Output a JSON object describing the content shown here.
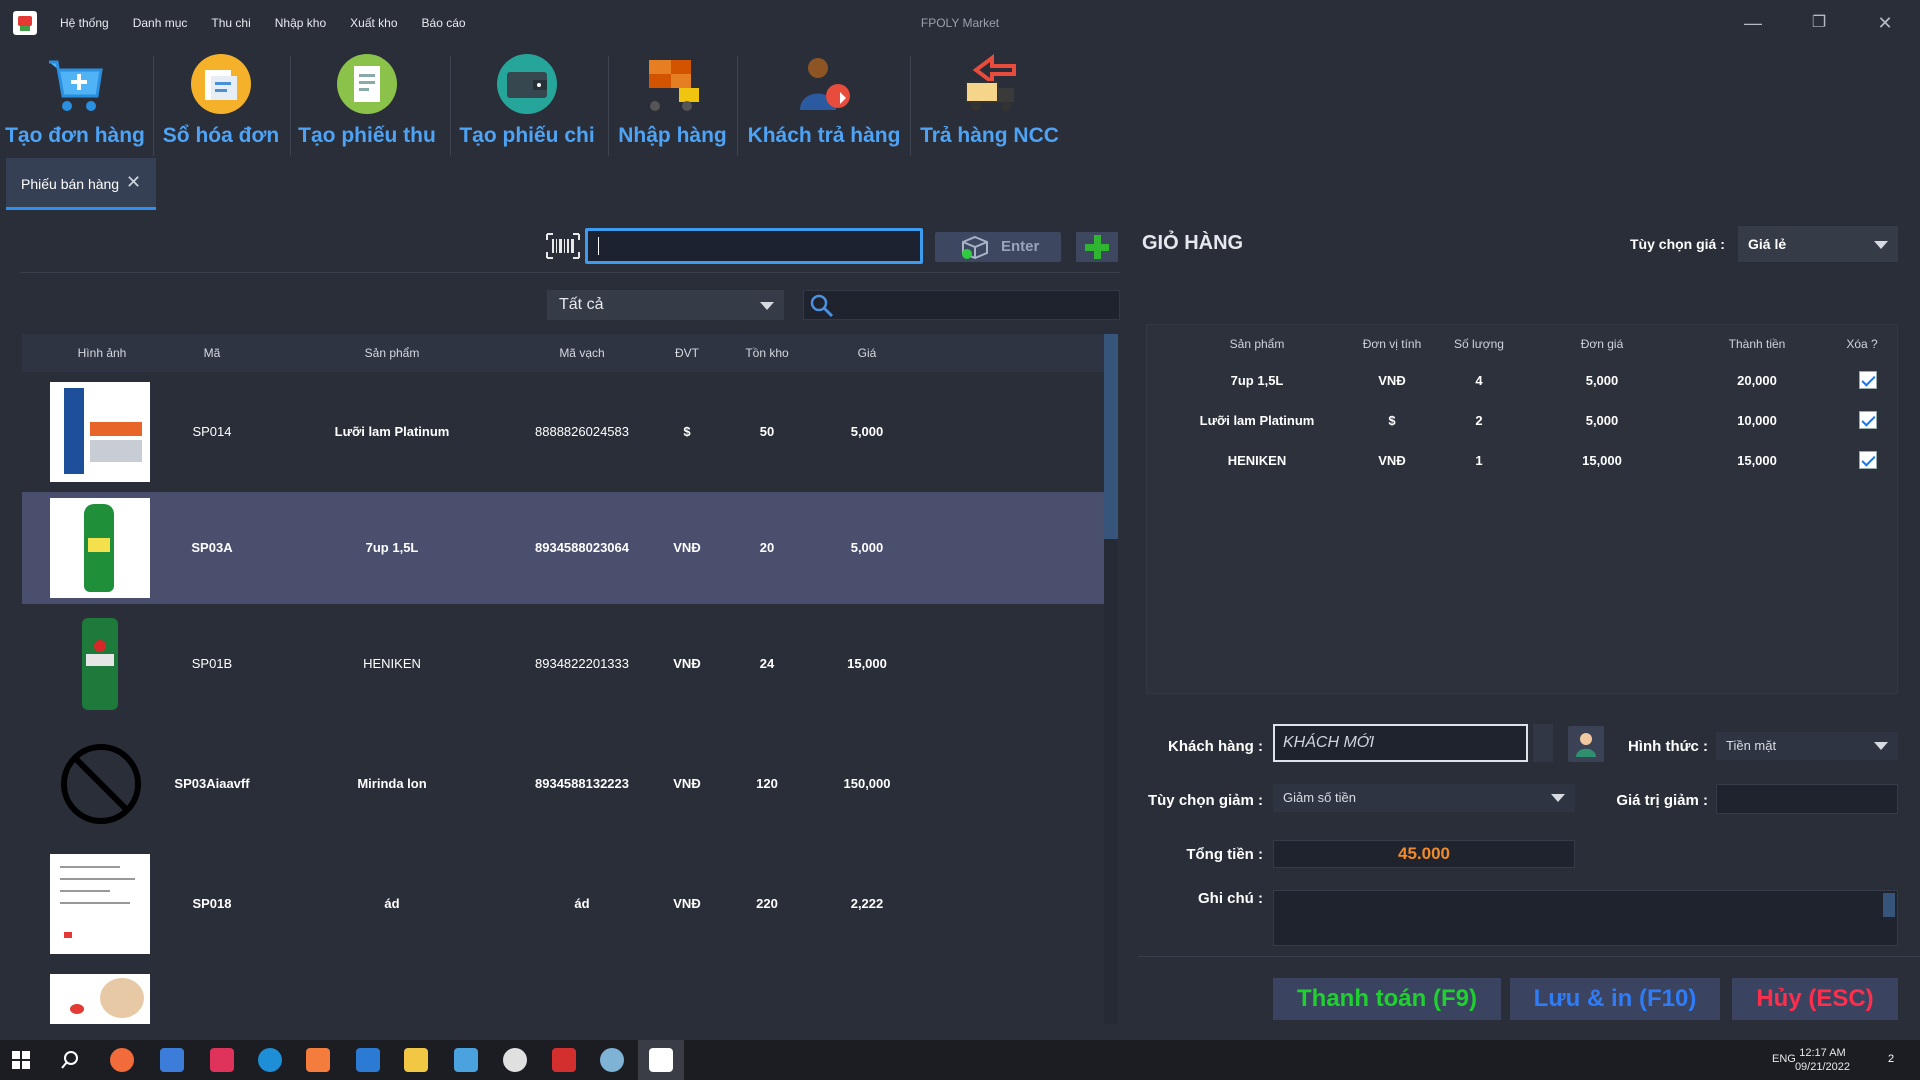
{
  "window": {
    "title": "FPOLY Market",
    "minimize": "—",
    "restore": "❐",
    "close": "✕"
  },
  "menu": [
    "Hệ thống",
    "Danh mục",
    "Thu chi",
    "Nhập kho",
    "Xuất kho",
    "Báo cáo"
  ],
  "toolbar": [
    {
      "label": "Tạo đơn hàng",
      "icon": "cart-add-icon"
    },
    {
      "label": "Sổ hóa đơn",
      "icon": "invoice-book-icon"
    },
    {
      "label": "Tạo phiếu thu",
      "icon": "receipt-icon"
    },
    {
      "label": "Tạo phiếu chi",
      "icon": "wallet-icon"
    },
    {
      "label": "Nhập hàng",
      "icon": "forklift-icon"
    },
    {
      "label": "Khách trả hàng",
      "icon": "customer-return-icon"
    },
    {
      "label": "Trả hàng NCC",
      "icon": "truck-return-icon"
    }
  ],
  "tab": {
    "label": "Phiếu bán hàng",
    "close": "✕"
  },
  "left": {
    "enter_label": "Enter",
    "category": "Tất cả",
    "columns": [
      "Hình ảnh",
      "Mã",
      "Sản phẩm",
      "Mã vạch",
      "ĐVT",
      "Tồn kho",
      "Giá"
    ],
    "rows": [
      {
        "code": "SP014",
        "name": "Lưỡi lam Platinum",
        "barcode": "8888826024583",
        "unit": "$",
        "stock": "50",
        "price": "5,000"
      },
      {
        "code": "SP03A",
        "name": "7up 1,5L",
        "barcode": "8934588023064",
        "unit": "VNĐ",
        "stock": "20",
        "price": "5,000"
      },
      {
        "code": "SP01B",
        "name": "HENIKEN",
        "barcode": "8934822201333",
        "unit": "VNĐ",
        "stock": "24",
        "price": "15,000"
      },
      {
        "code": "SP03Aiaavff",
        "name": "Mirinda lon",
        "barcode": "8934588132223",
        "unit": "VNĐ",
        "stock": "120",
        "price": "150,000"
      },
      {
        "code": "SP018",
        "name": "ád",
        "barcode": "ád",
        "unit": "VNĐ",
        "stock": "220",
        "price": "2,222"
      }
    ]
  },
  "cart": {
    "title": "GIỎ HÀNG",
    "price_option_label": "Tùy chọn giá :",
    "price_option": "Giá lẻ",
    "columns": [
      "Sản phẩm",
      "Đơn vị tính",
      "Số lượng",
      "Đơn giá",
      "Thành tiền",
      "Xóa ?"
    ],
    "rows": [
      {
        "name": "7up 1,5L",
        "unit": "VNĐ",
        "qty": "4",
        "unit_price": "5,000",
        "total": "20,000",
        "checked": true
      },
      {
        "name": "Lưỡi lam Platinum",
        "unit": "$",
        "qty": "2",
        "unit_price": "5,000",
        "total": "10,000",
        "checked": true
      },
      {
        "name": "HENIKEN",
        "unit": "VNĐ",
        "qty": "1",
        "unit_price": "15,000",
        "total": "15,000",
        "checked": true
      }
    ]
  },
  "form": {
    "customer_label": "Khách hàng :",
    "customer_value": "KHÁCH MỚI",
    "payment_label": "Hình thức :",
    "payment_value": "Tiền mặt",
    "discount_option_label": "Tùy chọn giảm :",
    "discount_option_value": "Giảm số tiền",
    "discount_value_label": "Giá trị giảm :",
    "total_label": "Tổng tiền :",
    "total_value": "45.000",
    "note_label": "Ghi chú :"
  },
  "actions": {
    "pay": "Thanh toán (F9)",
    "save_print": "Lưu & in (F10)",
    "cancel": "Hủy (ESC)"
  },
  "colors": {
    "pay": "#1fd12f",
    "save_print": "#2f7cf6",
    "cancel": "#ff2e4d",
    "accent": "#2f8ff0",
    "total": "#f08a2a"
  },
  "taskbar": {
    "lang": "ENG",
    "time": "12:17 AM",
    "date": "09/21/2022",
    "notif_count": "2"
  }
}
